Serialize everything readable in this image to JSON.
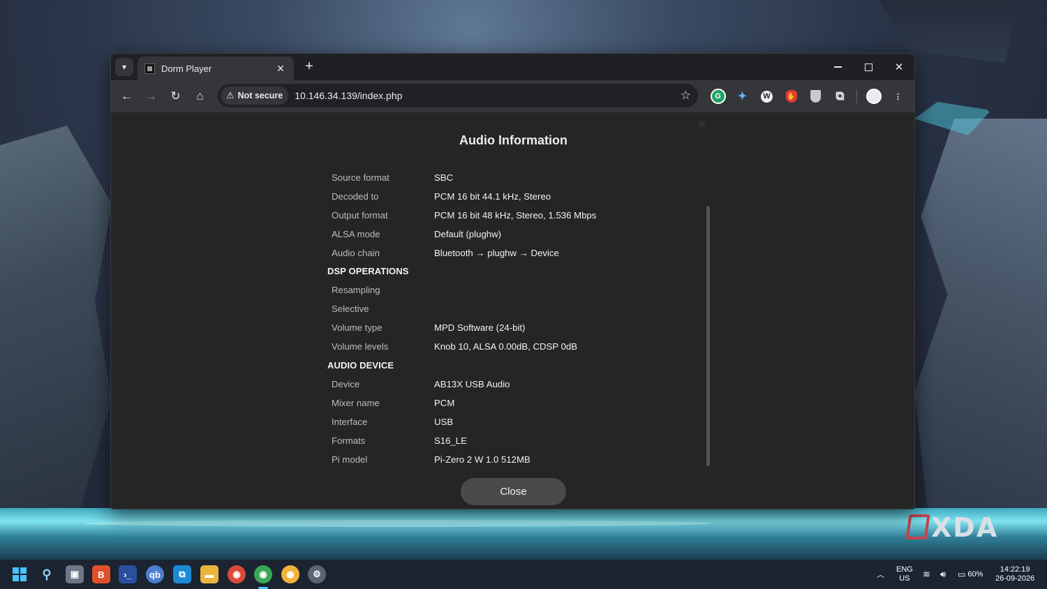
{
  "browser": {
    "tab_title": "Dorm Player",
    "security_label": "Not secure",
    "url": "10.146.34.139/index.php"
  },
  "modal": {
    "title": "Audio Information",
    "close_label": "Close",
    "rows": {
      "source_format": {
        "label": "Source format",
        "value": "SBC"
      },
      "decoded_to": {
        "label": "Decoded to",
        "value": "PCM 16 bit 44.1 kHz, Stereo"
      },
      "output_format": {
        "label": "Output format",
        "value": "PCM 16 bit 48 kHz, Stereo, 1.536 Mbps"
      },
      "alsa_mode": {
        "label": "ALSA mode",
        "value": "Default (plughw)"
      },
      "audio_chain": {
        "label": "Audio chain",
        "value": "Bluetooth → plughw → Device"
      },
      "resampling": {
        "label": "Resampling",
        "value": ""
      },
      "selective": {
        "label": "Selective",
        "value": ""
      },
      "volume_type": {
        "label": "Volume type",
        "value": "MPD Software (24-bit)"
      },
      "volume_levels": {
        "label": "Volume levels",
        "value": "Knob 10, ALSA 0.00dB, CDSP 0dB"
      },
      "device": {
        "label": "Device",
        "value": "AB13X USB Audio"
      },
      "mixer_name": {
        "label": "Mixer name",
        "value": "PCM"
      },
      "interface": {
        "label": "Interface",
        "value": "USB"
      },
      "formats": {
        "label": "Formats",
        "value": "S16_LE"
      },
      "pi_model": {
        "label": "Pi model",
        "value": "Pi-Zero 2 W 1.0 512MB"
      }
    },
    "sections": {
      "dsp": "DSP OPERATIONS",
      "audio_device": "AUDIO DEVICE"
    }
  },
  "taskbar": {
    "battery": "60%",
    "lang_line1": "ENG",
    "lang_line2": "US",
    "time": "14:22:19",
    "date": "26-09-2026"
  },
  "watermark": "XDA",
  "icons": {
    "security": "warning-triangle-icon",
    "bookmark": "star-icon",
    "extensions": "puzzle-icon"
  }
}
